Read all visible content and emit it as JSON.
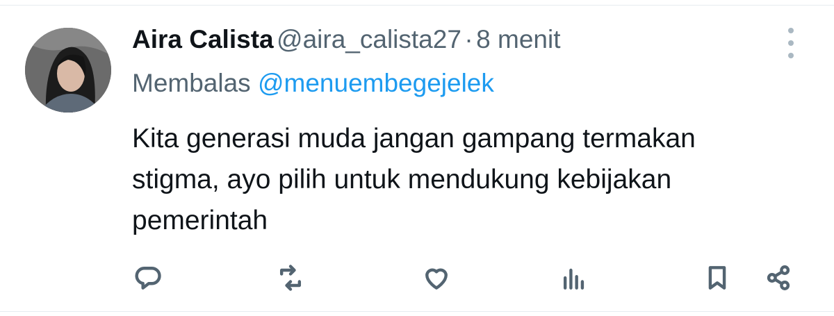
{
  "tweet": {
    "author_name": "Aira Calista",
    "handle": "@aira_calista27",
    "separator": "·",
    "time": "8 menit",
    "reply_prefix": "Membalas",
    "reply_to": "@menuembegejelek",
    "lines": [
      "Kita generasi muda jangan gampang termakan",
      "stigma, ayo pilih untuk mendukung kebijakan",
      "pemerintah"
    ]
  },
  "actions": [
    "reply-icon",
    "retweet-icon",
    "like-icon",
    "views-icon",
    "bookmark-icon",
    "share-icon"
  ],
  "colors": {
    "text": "#0f1419",
    "secondary": "#536471",
    "link": "#1d9bf0",
    "divider": "#e6ecf0"
  }
}
